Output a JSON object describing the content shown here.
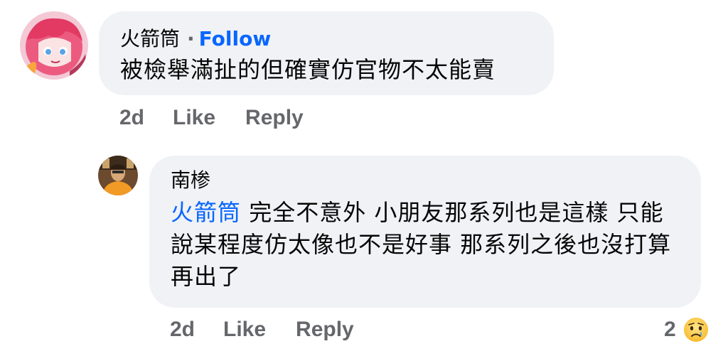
{
  "comments": [
    {
      "author": "火箭筒",
      "separator": "·",
      "follow_label": "Follow",
      "text": "被檢舉滿扯的但確實仿官物不太能賣",
      "time": "2d",
      "like_label": "Like",
      "reply_label": "Reply",
      "avatar_icon": "anime-girl-avatar-icon"
    },
    {
      "author": "南椮",
      "mention": "火箭筒",
      "text": "完全不意外 小朋友那系列也是這樣 只能說某程度仿太像也不是好事 那系列之後也沒打算再出了",
      "time": "2d",
      "like_label": "Like",
      "reply_label": "Reply",
      "avatar_icon": "person-photo-avatar-icon",
      "reaction": {
        "count": "2",
        "icon": "sad-reaction-icon"
      }
    }
  ],
  "colors": {
    "bubble": "#f0f2f5",
    "link": "#0866ff",
    "secondary_text": "#65676b",
    "primary_text": "#050505"
  }
}
